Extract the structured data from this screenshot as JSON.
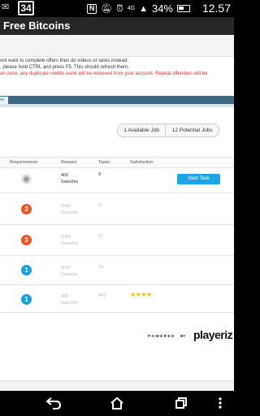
{
  "status_bar": {
    "badge": "34",
    "network": "4G",
    "battery_percent": "34%",
    "time": "12.57"
  },
  "app": {
    "title": "Free Bitcoins"
  },
  "messages": {
    "line1": "ont want to complete offers then do videos or tasks instead.",
    "line2": ", please hold CTRL and press F5. This should refresh them.",
    "line3": "an once, any duplicate credits earnt will be removed from your account. Repeat offenders will be"
  },
  "tab": {
    "label": "es"
  },
  "counts": {
    "available_job": "1 Available Job",
    "potential_jobs": "12 Potential Jobs"
  },
  "table": {
    "headers": {
      "requirements": "Requirements",
      "reward": "Reward",
      "tasks": "Tasks",
      "satisfaction": "Satisfaction"
    },
    "rows": [
      {
        "icon": "grey-badge-icon",
        "icon_text": "",
        "reward_amount": "400",
        "reward_unit": "Satoshis",
        "tasks": "9",
        "stars": "",
        "enabled": true,
        "action": "Start Task"
      },
      {
        "icon": "orange-level-3-icon",
        "icon_text": "3",
        "reward_amount": "2000",
        "reward_unit": "Satoshis",
        "tasks": "9",
        "stars": "",
        "enabled": false,
        "action": ""
      },
      {
        "icon": "orange-level-3-icon",
        "icon_text": "3",
        "reward_amount": "2000",
        "reward_unit": "Satoshis",
        "tasks": "97",
        "stars": "",
        "enabled": false,
        "action": ""
      },
      {
        "icon": "blue-level-1-icon",
        "icon_text": "1",
        "reward_amount": "6000",
        "reward_unit": "Satoshis",
        "tasks": "10",
        "stars": "",
        "enabled": false,
        "action": ""
      },
      {
        "icon": "blue-level-1-icon",
        "icon_text": "1",
        "reward_amount": "400",
        "reward_unit": "Satoshis",
        "tasks": "443",
        "stars": "★★★★",
        "enabled": false,
        "action": ""
      }
    ]
  },
  "footer": {
    "powered": "POWERED",
    "by": "BY",
    "logo": "playeriz"
  },
  "colors": {
    "accent_blue": "#1ea5e0",
    "tab_bar": "#3c6a86",
    "orange_badge": "#e8562a",
    "blue_badge": "#1c9ed8",
    "star": "#e8c200",
    "red_text": "#e03030"
  }
}
